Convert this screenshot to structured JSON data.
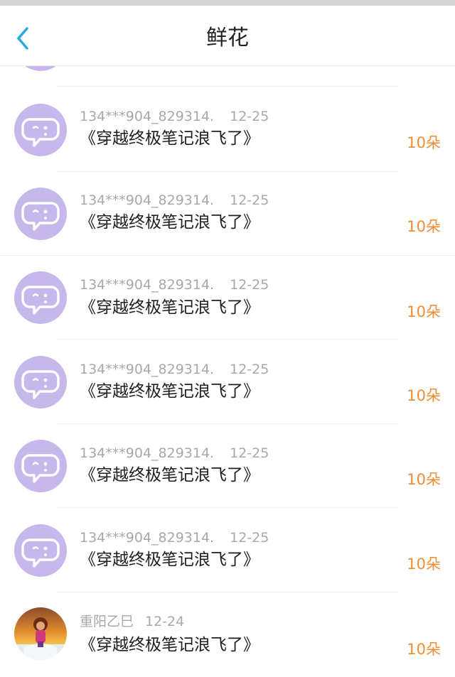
{
  "header": {
    "title": "鲜花",
    "back_icon": "chevron-left-icon",
    "accent": "#2aa8e3"
  },
  "colors": {
    "amount": "#f08c32",
    "avatar_bg": "#c7b8ec",
    "meta": "#a8a8a8"
  },
  "rows": [
    {
      "user": "134***904_829314.",
      "date": "12-25",
      "book": "《穿越终极笔记浪飞了》",
      "amount": "10朵",
      "avatar": "chat-bubble-icon"
    },
    {
      "user": "134***904_829314.",
      "date": "12-25",
      "book": "《穿越终极笔记浪飞了》",
      "amount": "10朵",
      "avatar": "chat-bubble-icon"
    },
    {
      "user": "134***904_829314.",
      "date": "12-25",
      "book": "《穿越终极笔记浪飞了》",
      "amount": "10朵",
      "avatar": "chat-bubble-icon"
    },
    {
      "user": "134***904_829314.",
      "date": "12-25",
      "book": "《穿越终极笔记浪飞了》",
      "amount": "10朵",
      "avatar": "chat-bubble-icon"
    },
    {
      "user": "134***904_829314.",
      "date": "12-25",
      "book": "《穿越终极笔记浪飞了》",
      "amount": "10朵",
      "avatar": "chat-bubble-icon"
    },
    {
      "user": "134***904_829314.",
      "date": "12-25",
      "book": "《穿越终极笔记浪飞了》",
      "amount": "10朵",
      "avatar": "chat-bubble-icon"
    },
    {
      "user": "重阳乙巳",
      "date": "12-24",
      "book": "《穿越终极笔记浪飞了》",
      "amount": "10朵",
      "avatar": "user-photo"
    }
  ]
}
